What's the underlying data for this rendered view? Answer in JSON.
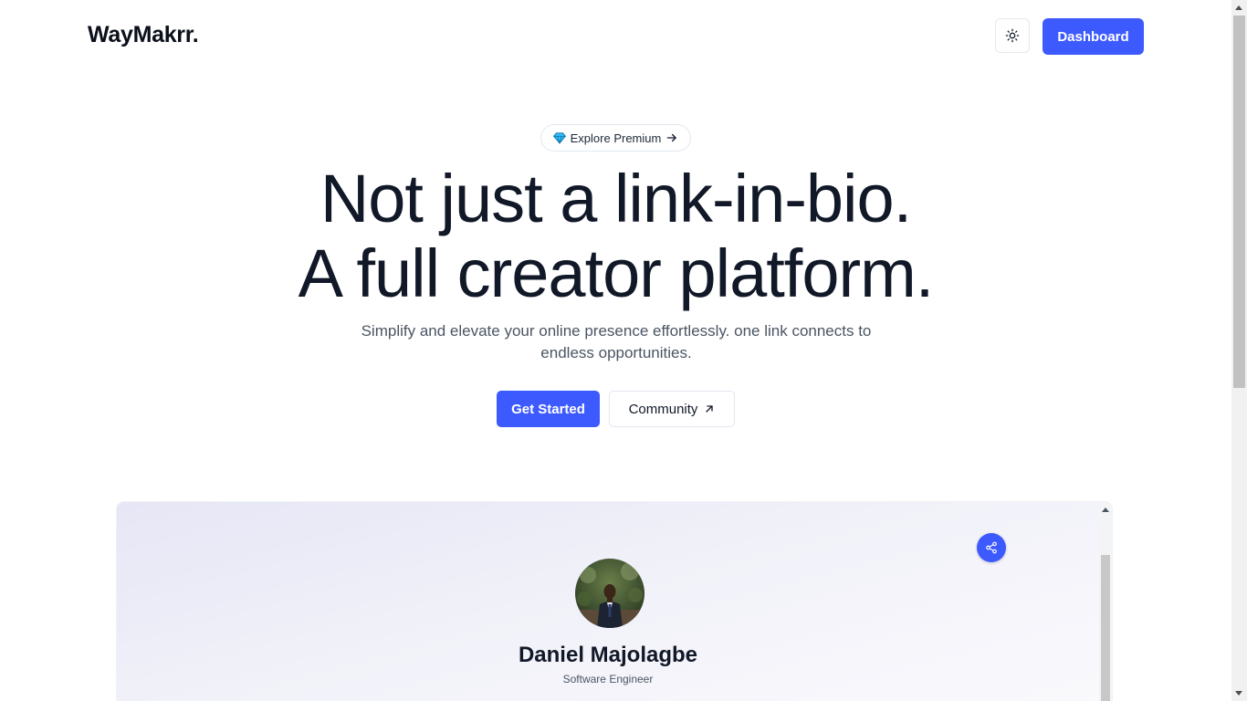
{
  "header": {
    "logo": "WayMakrr.",
    "theme_toggle_icon": "sun-icon",
    "dashboard_label": "Dashboard"
  },
  "hero": {
    "pill_icon": "diamond-icon",
    "pill_label": "Explore Premium",
    "pill_arrow_icon": "arrow-right-icon",
    "headline_line1": "Not just a link-in-bio.",
    "headline_line2": "A full creator platform.",
    "subtitle": "Simplify and elevate your online presence effortlessly. one link connects to endless opportunities.",
    "get_started_label": "Get Started",
    "community_label": "Community",
    "community_icon": "arrow-up-right-icon"
  },
  "preview": {
    "share_icon": "share-icon",
    "profile_name": "Daniel Majolagbe",
    "profile_title": "Software Engineer"
  },
  "colors": {
    "accent": "#3d5afe",
    "text": "#111827",
    "muted": "#4b5563"
  }
}
